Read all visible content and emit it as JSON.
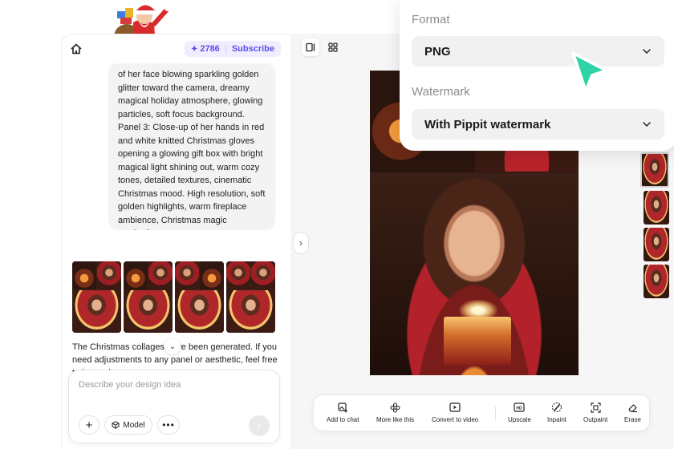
{
  "header": {
    "credits": "2786",
    "subscribe_label": "Subscribe"
  },
  "chat": {
    "prompt_text": "of her face blowing sparkling golden glitter toward the camera, dreamy magical holiday atmosphere, glowing particles, soft focus background. Panel 3: Close-up of her hands in red and white knitted Christmas gloves opening a glowing gift box with bright magical light shining out, warm cozy tones, detailed textures, cinematic Christmas mood. High resolution, soft golden highlights, warm fireplace ambience, Christmas magic aesthetic.",
    "status_text": "The Christmas collages have been generated. If you need adjustments to any panel or aesthetic, feel free to let me know.",
    "input_placeholder": "Describe your design idea",
    "model_label": "Model"
  },
  "toolbar": {
    "add_to_chat": "Add to chat",
    "more_like_this": "More like this",
    "convert_to_video": "Convert to video",
    "upscale": "Upscale",
    "inpaint": "Inpaint",
    "outpaint": "Outpaint",
    "erase": "Erase"
  },
  "export": {
    "format_label": "Format",
    "format_value": "PNG",
    "watermark_label": "Watermark",
    "watermark_value": "With Pippit watermark"
  },
  "colors": {
    "accent": "#5b4ee6",
    "cursor": "#2ed3a6"
  }
}
